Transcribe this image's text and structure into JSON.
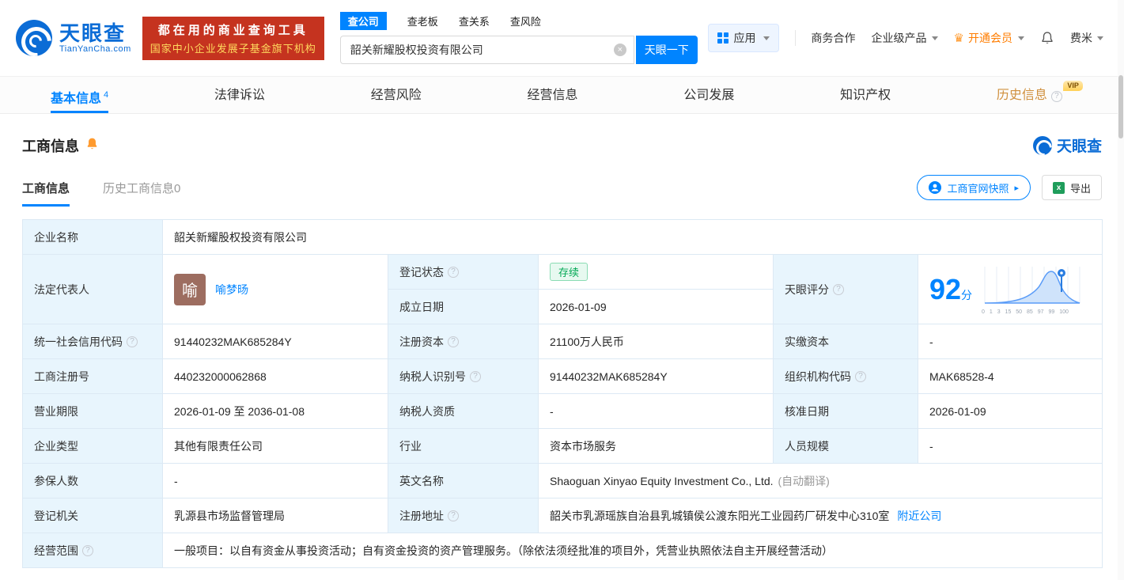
{
  "header": {
    "logo": {
      "brand": "天眼查",
      "domain": "TianYanCha.com"
    },
    "slogan": {
      "line1": "都在用的商业查询工具",
      "line2": "国家中小企业发展子基金旗下机构"
    },
    "search": {
      "tabs": [
        {
          "label": "查公司"
        },
        {
          "label": "查老板"
        },
        {
          "label": "查关系"
        },
        {
          "label": "查风险"
        }
      ],
      "value": "韶关新耀股权投资有限公司",
      "clear": "×",
      "button": "天眼一下"
    },
    "nav": {
      "apps": "应用",
      "cooperation": "商务合作",
      "enterprise": "企业级产品",
      "vip": "开通会员",
      "user": "费米"
    }
  },
  "tabbar": {
    "items": [
      {
        "label": "基本信息",
        "count": "4"
      },
      {
        "label": "法律诉讼"
      },
      {
        "label": "经营风险"
      },
      {
        "label": "经营信息"
      },
      {
        "label": "公司发展"
      },
      {
        "label": "知识产权"
      },
      {
        "label": "历史信息",
        "badge": "VIP"
      }
    ]
  },
  "section": {
    "title": "工商信息",
    "brand": "天眼查",
    "subtabs": [
      {
        "label": "工商信息"
      },
      {
        "label": "历史工商信息0"
      }
    ],
    "snapshot_button": "工商官网快照",
    "export_button": "导出"
  },
  "fields": {
    "company_name": {
      "label": "企业名称",
      "value": "韶关新耀股权投资有限公司"
    },
    "legal_rep": {
      "label": "法定代表人",
      "avatar": "喻",
      "value": "喻梦旸"
    },
    "reg_status": {
      "label": "登记状态",
      "value": "存续"
    },
    "establish_date": {
      "label": "成立日期",
      "value": "2026-01-09"
    },
    "score": {
      "label": "天眼评分",
      "value": "92",
      "unit": "分",
      "ticks": "0 1 3 15 50 85 97 99 100"
    },
    "credit_code": {
      "label": "统一社会信用代码",
      "value": "91440232MAK685284Y"
    },
    "reg_capital": {
      "label": "注册资本",
      "value": "21100万人民币"
    },
    "paid_capital": {
      "label": "实缴资本",
      "value": "-"
    },
    "reg_number": {
      "label": "工商注册号",
      "value": "440232000062868"
    },
    "taxpayer_id": {
      "label": "纳税人识别号",
      "value": "91440232MAK685284Y"
    },
    "org_code": {
      "label": "组织机构代码",
      "value": "MAK68528-4"
    },
    "business_term": {
      "label": "营业期限",
      "value": "2026-01-09 至 2036-01-08"
    },
    "taxpayer_quality": {
      "label": "纳税人资质",
      "value": "-"
    },
    "approval_date": {
      "label": "核准日期",
      "value": "2026-01-09"
    },
    "company_type": {
      "label": "企业类型",
      "value": "其他有限责任公司"
    },
    "industry": {
      "label": "行业",
      "value": "资本市场服务"
    },
    "staff_size": {
      "label": "人员规模",
      "value": "-"
    },
    "insured_count": {
      "label": "参保人数",
      "value": "-"
    },
    "english_name": {
      "label": "英文名称",
      "value": "Shaoguan Xinyao Equity Investment Co., Ltd.",
      "note": "(自动翻译)"
    },
    "reg_authority": {
      "label": "登记机关",
      "value": "乳源县市场监督管理局"
    },
    "reg_address": {
      "label": "注册地址",
      "value": "韶关市乳源瑶族自治县乳城镇侯公渡东阳光工业园药厂研发中心310室",
      "link": "附近公司"
    },
    "business_scope": {
      "label": "经营范围",
      "value": "一般项目：以自有资金从事投资活动；自有资金投资的资产管理服务。（除依法须经批准的项目外，凭营业执照依法自主开展经营活动）"
    }
  }
}
